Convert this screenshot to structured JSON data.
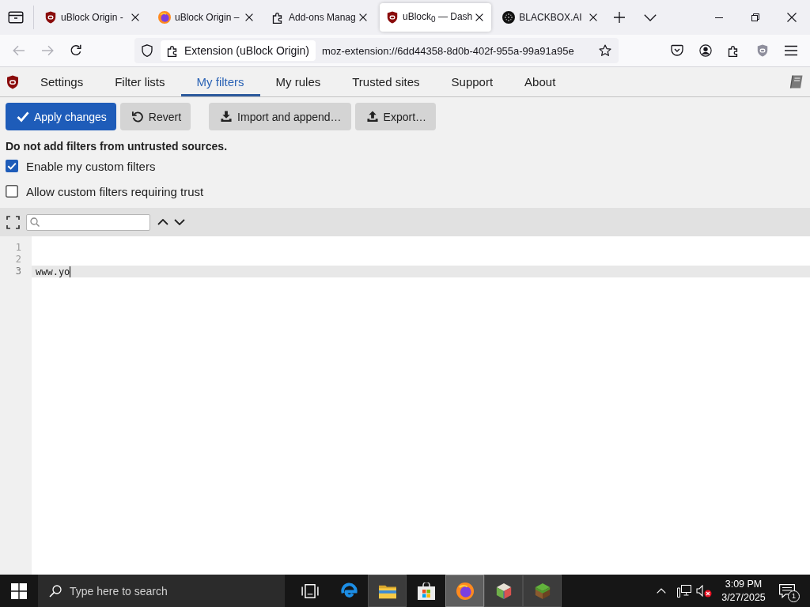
{
  "browser": {
    "tabs": [
      {
        "kind": "shield",
        "title": "uBlock Origin -",
        "selected": false
      },
      {
        "kind": "globe",
        "title": "uBlock Origin –",
        "selected": false
      },
      {
        "kind": "puzzle",
        "title": "Add-ons Manag",
        "selected": false
      },
      {
        "kind": "shield",
        "title": "uBlock$_{0}$ — Dash",
        "selected": true
      },
      {
        "kind": "dots",
        "title": "BLACKBOX.AI",
        "selected": false
      }
    ],
    "back": {
      "disabled": true
    },
    "forward": {
      "disabled": true
    },
    "address_bar": {
      "identity": "Extension (uBlock Origin)",
      "url": "moz-extension://6dd44358-8d0b-402f-955a-99a91a95e"
    }
  },
  "dashboard": {
    "tabs": [
      {
        "label": "Settings",
        "selected": false
      },
      {
        "label": "Filter lists",
        "selected": false
      },
      {
        "label": "My filters",
        "selected": true
      },
      {
        "label": "My rules",
        "selected": false
      },
      {
        "label": "Trusted sites",
        "selected": false
      },
      {
        "label": "Support",
        "selected": false
      },
      {
        "label": "About",
        "selected": false
      }
    ],
    "buttons": [
      {
        "kind": "apply",
        "label": "Apply changes"
      },
      {
        "kind": "revert",
        "label": "Revert"
      },
      {
        "kind": "import",
        "label": "Import and append…"
      },
      {
        "kind": "export",
        "label": "Export…"
      }
    ],
    "warning": "Do not add filters from untrusted sources.",
    "options": [
      {
        "label": "Enable my custom filters",
        "checked": true
      },
      {
        "label": "Allow custom filters requiring trust",
        "checked": false
      }
    ]
  },
  "editor": {
    "lines": [
      {
        "number": "1",
        "current": false
      },
      {
        "number": "2",
        "current": false
      },
      {
        "number": "3",
        "text": "www.yo",
        "current": true
      }
    ]
  },
  "taskbar": {
    "search": {
      "placeholder": "Type here to search"
    },
    "apps": [
      {
        "kind": "task-view",
        "open": false,
        "selected": false
      },
      {
        "kind": "edge",
        "open": false,
        "selected": false
      },
      {
        "kind": "folder",
        "open": true,
        "selected": false
      },
      {
        "kind": "store",
        "open": false,
        "selected": false
      },
      {
        "kind": "browser",
        "open": true,
        "selected": true
      },
      {
        "kind": "cube",
        "open": true,
        "selected": false
      },
      {
        "kind": "block",
        "open": true,
        "selected": false
      }
    ],
    "time": "3:09 PM",
    "date": "3/27/2025",
    "notification_count": "1"
  }
}
